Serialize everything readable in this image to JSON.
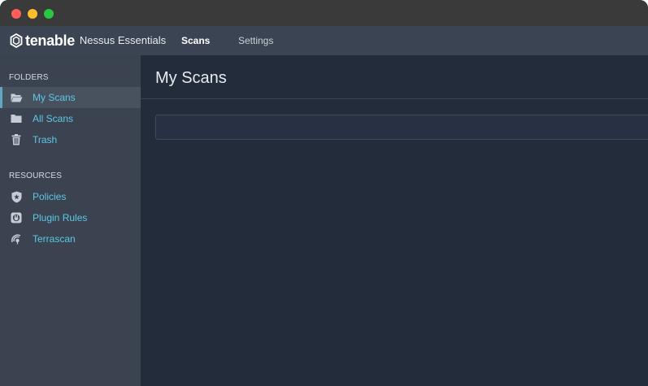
{
  "window": {
    "traffic_lights": [
      "close",
      "minimize",
      "maximize"
    ],
    "colors": {
      "close": "#fe5f57",
      "minimize": "#febc2e",
      "maximize": "#28c840"
    }
  },
  "header": {
    "brand": "tenable",
    "product": "Nessus Essentials",
    "nav": [
      {
        "label": "Scans",
        "active": true
      },
      {
        "label": "Settings",
        "active": false
      }
    ]
  },
  "sidebar": {
    "folders_label": "FOLDERS",
    "folders": [
      {
        "label": "My Scans",
        "icon": "folder-open-icon",
        "selected": true
      },
      {
        "label": "All Scans",
        "icon": "folder-icon",
        "selected": false
      },
      {
        "label": "Trash",
        "icon": "trash-icon",
        "selected": false
      }
    ],
    "resources_label": "RESOURCES",
    "resources": [
      {
        "label": "Policies",
        "icon": "shield-icon"
      },
      {
        "label": "Plugin Rules",
        "icon": "plugin-icon"
      },
      {
        "label": "Terrascan",
        "icon": "radar-icon"
      }
    ]
  },
  "main": {
    "title": "My Scans",
    "search_value": ""
  },
  "colors": {
    "accent_link": "#5ec7e6",
    "selected_bar": "#5fa8c4",
    "main_bg": "#232c3b",
    "sidebar_bg": "#3b4350"
  }
}
